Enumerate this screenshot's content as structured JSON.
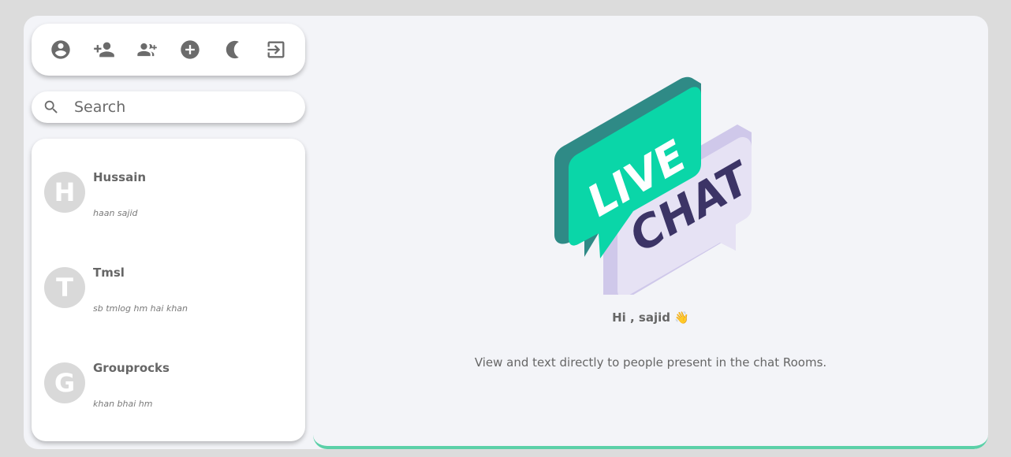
{
  "toolbar": {
    "icons": [
      "account-circle-icon",
      "add-user-icon",
      "add-group-icon",
      "add-circle-icon",
      "dark-mode-icon",
      "logout-icon"
    ]
  },
  "search": {
    "placeholder": "Search"
  },
  "chats": [
    {
      "initial": "H",
      "name": "Hussain",
      "last_message": "haan sajid"
    },
    {
      "initial": "T",
      "name": "Tmsl",
      "last_message": "sb tmlog hm hai khan"
    },
    {
      "initial": "G",
      "name": "Grouprocks",
      "last_message": "khan bhai hm"
    }
  ],
  "welcome": {
    "logo_line1": "LIVE",
    "logo_line2": "CHAT",
    "greeting": "Hi , sajid 👋",
    "description": "View and text directly to people present in the chat Rooms."
  },
  "colors": {
    "accent": "#5bd0a8",
    "logo_green": "#0ad6a8",
    "logo_purple": "#e6e2f4",
    "logo_text_dark": "#3c3466"
  }
}
